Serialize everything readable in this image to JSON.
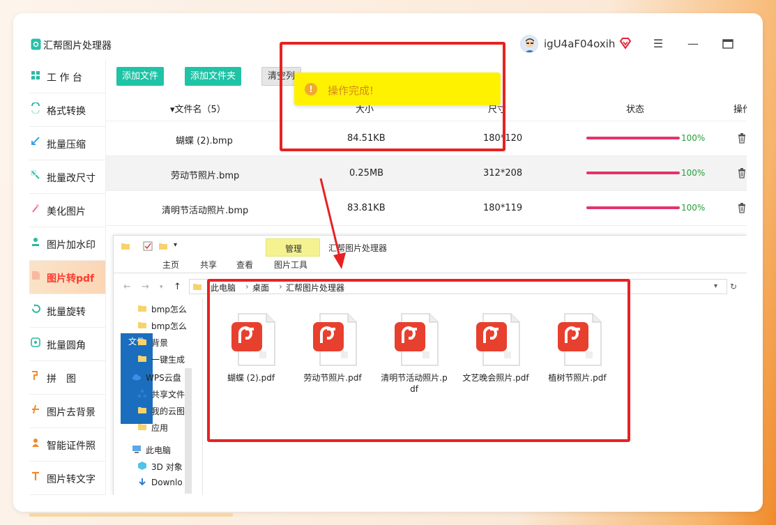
{
  "app": {
    "title": "汇帮图片处理器",
    "username": "igU4aF04oxih"
  },
  "colors": {
    "accent": "#1fc3a5",
    "active_text": "#ff3b30",
    "progress": "#e5336b",
    "percent": "#25a038",
    "toast": "#fff200",
    "highlight": "#e62222"
  },
  "sidebar": {
    "items": [
      {
        "label": "工 作 台",
        "icon": "workbench-icon"
      },
      {
        "label": "格式转换",
        "icon": "format-convert-icon"
      },
      {
        "label": "批量压缩",
        "icon": "compress-icon"
      },
      {
        "label": "批量改尺寸",
        "icon": "resize-icon"
      },
      {
        "label": "美化图片",
        "icon": "beautify-icon"
      },
      {
        "label": "图片加水印",
        "icon": "watermark-icon"
      },
      {
        "label": "图片转pdf",
        "icon": "image-to-pdf-icon",
        "active": true
      },
      {
        "label": "批量旋转",
        "icon": "rotate-icon"
      },
      {
        "label": "批量圆角",
        "icon": "round-corner-icon"
      },
      {
        "label": "拼　图",
        "icon": "puzzle-icon"
      },
      {
        "label": "图片去背景",
        "icon": "remove-bg-icon"
      },
      {
        "label": "智能证件照",
        "icon": "id-photo-icon"
      },
      {
        "label": "图片转文字",
        "icon": "ocr-icon"
      }
    ]
  },
  "toolbar": {
    "add_file": "添加文件",
    "add_folder": "添加文件夹",
    "clear_list": "清空列"
  },
  "table": {
    "headers": {
      "name": "▾文件名（5）",
      "size": "大小",
      "dims": "尺寸",
      "status": "状态",
      "actions": "操作"
    },
    "rows": [
      {
        "name": "蝴蝶 (2).bmp",
        "size": "84.51KB",
        "dims": "180*120",
        "progress": 100,
        "percent": "100%"
      },
      {
        "name": "劳动节照片.bmp",
        "size": "0.25MB",
        "dims": "312*208",
        "progress": 100,
        "percent": "100%"
      },
      {
        "name": "清明节活动照片.bmp",
        "size": "83.81KB",
        "dims": "180*119",
        "progress": 100,
        "percent": "100%"
      }
    ]
  },
  "toast": {
    "message": "操作完成!"
  },
  "explorer": {
    "title": "汇帮图片处理器",
    "tool_tab": "管理",
    "ribbon": {
      "file": "文件",
      "home": "主页",
      "share": "共享",
      "view": "查看",
      "picture_tools": "图片工具"
    },
    "breadcrumb": [
      "此电脑",
      "桌面",
      "汇帮图片处理器"
    ],
    "nav": [
      "bmp怎么",
      "bmp怎么",
      "背景",
      "一键生成",
      "WPS云盘",
      "共享文件",
      "我的云图",
      "应用",
      "此电脑",
      "3D 对象",
      "Downlo"
    ],
    "files": [
      "蝴蝶 (2).pdf",
      "劳动节照片.pdf",
      "清明节活动照片.pdf",
      "文艺晚会照片.pdf",
      "植树节照片.pdf"
    ]
  }
}
